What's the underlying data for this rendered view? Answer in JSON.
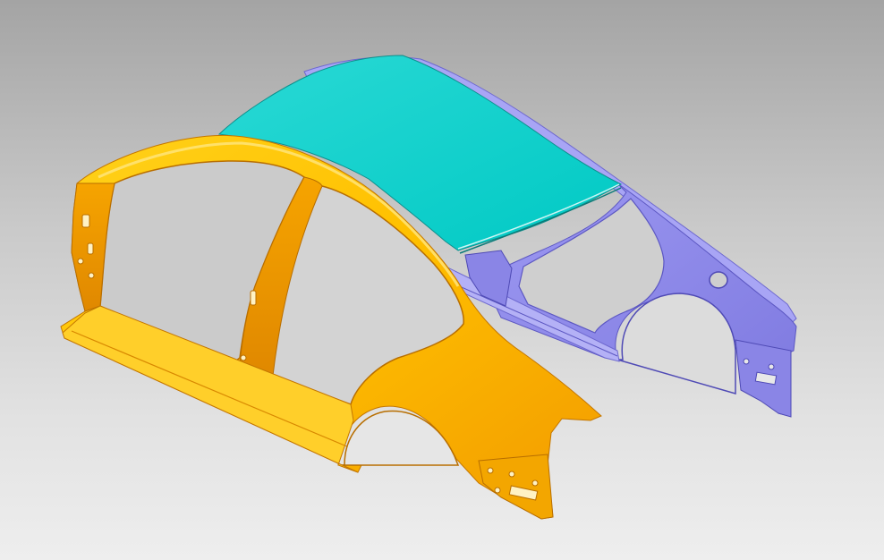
{
  "viewport": {
    "background_top": "#a4a4a4",
    "background_bottom": "#eeeeee"
  },
  "model": {
    "parts": [
      {
        "name": "roof-panel",
        "color": "#00d3cf"
      },
      {
        "name": "left-body-side",
        "color": "#ffbe00"
      },
      {
        "name": "right-body-side",
        "color": "#8b86ea"
      }
    ]
  }
}
